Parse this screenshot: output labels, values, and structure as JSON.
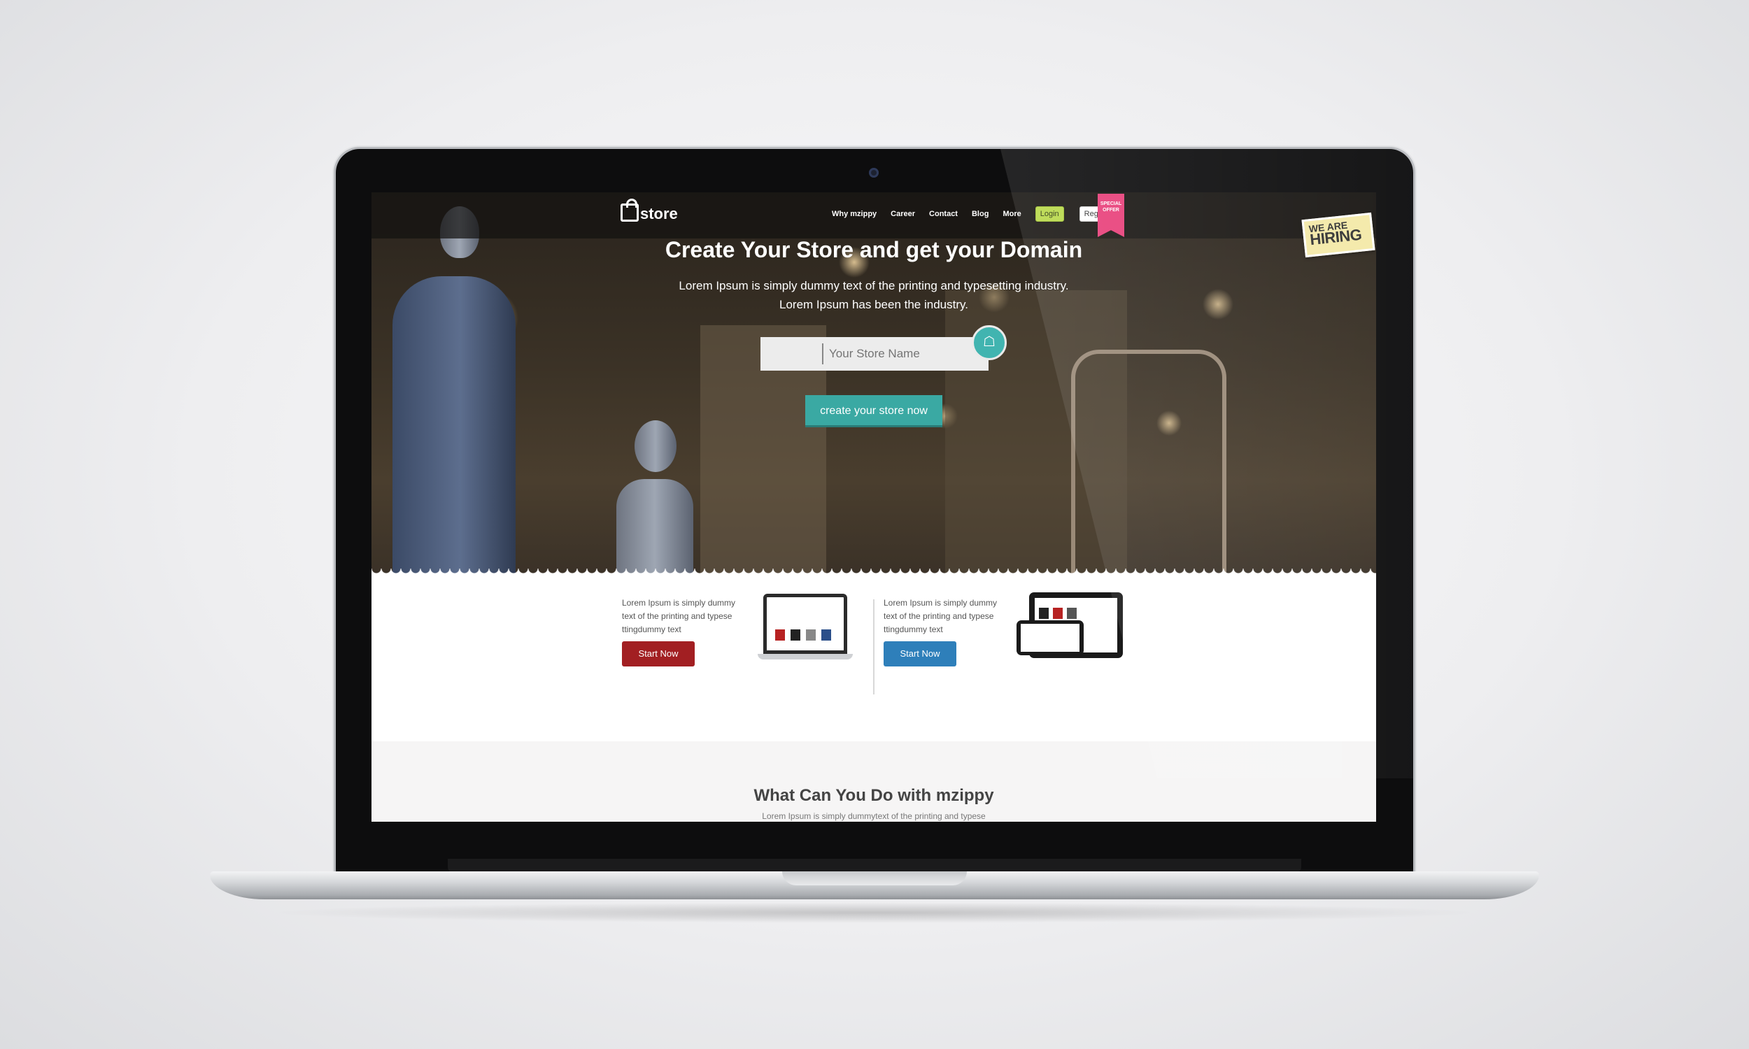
{
  "site": {
    "logo_text": "store",
    "nav": {
      "items": [
        "Why mzippy",
        "Career",
        "Contact",
        "Blog",
        "More"
      ],
      "login_label": "Login",
      "register_label": "Register"
    },
    "badges": {
      "special_offer": "SPECIAL OFFER",
      "hiring_line1": "WE ARE",
      "hiring_line2": "HIRING"
    },
    "hero": {
      "title": "Create Your Store and get your Domain",
      "subtitle_line1": "Lorem Ipsum is simply dummy text of the printing and typesetting industry.",
      "subtitle_line2": "Lorem Ipsum has been the industry.",
      "input_placeholder": "Your Store Name",
      "cta_label": "create your store now"
    },
    "features": [
      {
        "text": "Lorem Ipsum is simply dummy text of the printing and typese ttingdummy text",
        "button_label": "Start Now"
      },
      {
        "text": "Lorem Ipsum is simply dummy text of the printing and typese ttingdummy text",
        "button_label": "Start Now"
      }
    ],
    "section2": {
      "title": "What Can You Do with mzippy",
      "subtitle": "Lorem Ipsum is simply dummytext of the printing and typese"
    }
  },
  "colors": {
    "accent_teal": "#3aa9a3",
    "login_green": "#b8d84a",
    "red_button": "#a21f22",
    "blue_button": "#2e7fba",
    "ribbon_pink": "#e8407a"
  },
  "icons": [
    "shopping-bag-icon",
    "storefront-icon"
  ]
}
